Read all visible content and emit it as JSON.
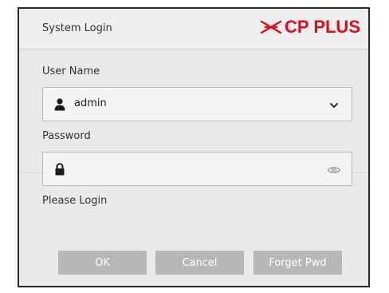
{
  "dialog": {
    "title": "System Login",
    "brand": "CP PLUS",
    "brand_color": "#e00b1c"
  },
  "username": {
    "label": "User Name",
    "value": "admin",
    "lead_icon": "user-icon",
    "trail_icon": "chevron-down-icon"
  },
  "password": {
    "label": "Password",
    "value": "",
    "lead_icon": "lock-icon",
    "trail_icon": "eye-icon"
  },
  "status": {
    "text": "Please Login"
  },
  "buttons": {
    "ok": "OK",
    "cancel": "Cancel",
    "forget": "Forget Pwd",
    "color": "#b7b7b7"
  }
}
